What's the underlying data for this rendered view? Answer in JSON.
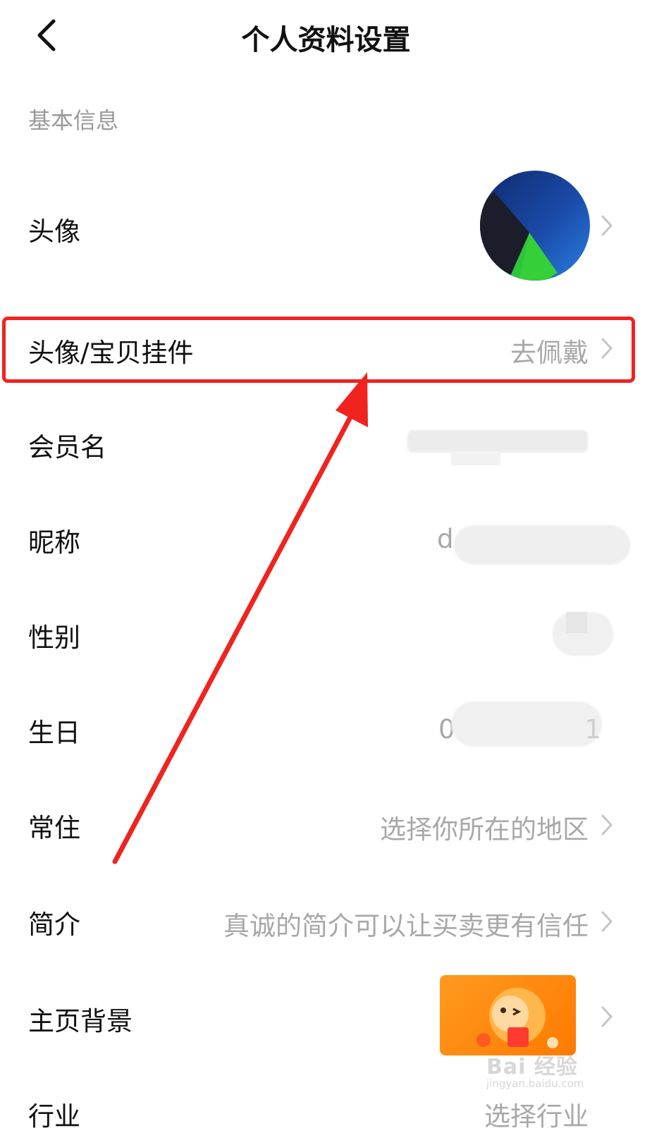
{
  "header": {
    "title": "个人资料设置"
  },
  "section": {
    "basic_info": "基本信息"
  },
  "rows": {
    "avatar": {
      "label": "头像"
    },
    "pendant": {
      "label": "头像/宝贝挂件",
      "value": "去佩戴"
    },
    "member_name": {
      "label": "会员名"
    },
    "nickname": {
      "label": "昵称",
      "value_prefix": "d"
    },
    "gender": {
      "label": "性别"
    },
    "birthday": {
      "label": "生日",
      "value_prefix": "0",
      "value_suffix": "1"
    },
    "residence": {
      "label": "常住",
      "value": "选择你所在的地区"
    },
    "bio": {
      "label": "简介",
      "value": "真诚的简介可以让买卖更有信任"
    },
    "homepage_bg": {
      "label": "主页背景"
    },
    "industry": {
      "label": "行业",
      "value": "选择行业"
    }
  },
  "annotation": {
    "color": "#f0231f"
  },
  "watermark": {
    "main": "Bai 经验",
    "sub": "jingyan.baidu.com"
  },
  "icons": {
    "back": "chevron-left-icon",
    "row_arrow": "chevron-right-icon"
  }
}
